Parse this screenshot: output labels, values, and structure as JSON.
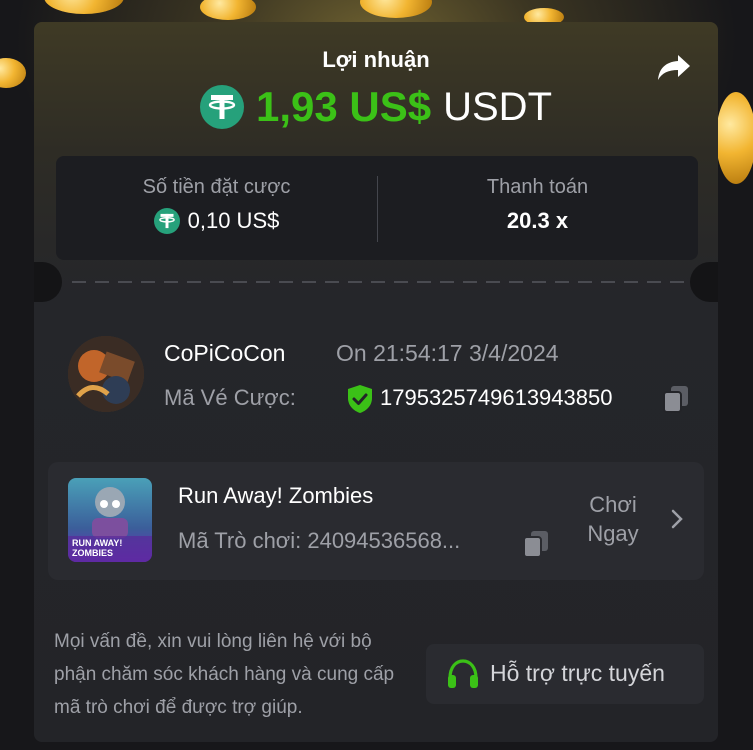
{
  "colors": {
    "profit_green": "#3bc117",
    "tether_green": "#26a17b",
    "accent_green": "#3bc117"
  },
  "header": {
    "title": "Lợi nhuận",
    "profit_amount": "1,93 US$",
    "profit_currency": "USDT",
    "currency_icon": "tether-icon",
    "share_icon": "share-icon"
  },
  "stats": {
    "bet_label": "Số tiền đặt cược",
    "bet_value": "0,10 US$",
    "payout_label": "Thanh toán",
    "payout_value": "20.3 x"
  },
  "bet_info": {
    "username": "CoPiCoCon",
    "datetime": "On 21:54:17 3/4/2024",
    "ticket_label": "Mã Vé Cược:",
    "ticket_id": "1795325749613943850",
    "verified_icon": "shield-check-icon",
    "copy_icon": "copy-icon"
  },
  "game": {
    "name": "Run Away! Zombies",
    "id_text": "Mã Trò chơi: 24094536568...",
    "play_label": "Chơi Ngay",
    "thumb_text": "RUN AWAY! ZOMBIES"
  },
  "help": {
    "message": "Mọi vấn đề, xin vui lòng liên hệ với bộ phận chăm sóc khách hàng và cung cấp mã trò chơi để được trợ giúp.",
    "support_label": "Hỗ trợ trực tuyến",
    "support_icon": "headset-icon"
  }
}
